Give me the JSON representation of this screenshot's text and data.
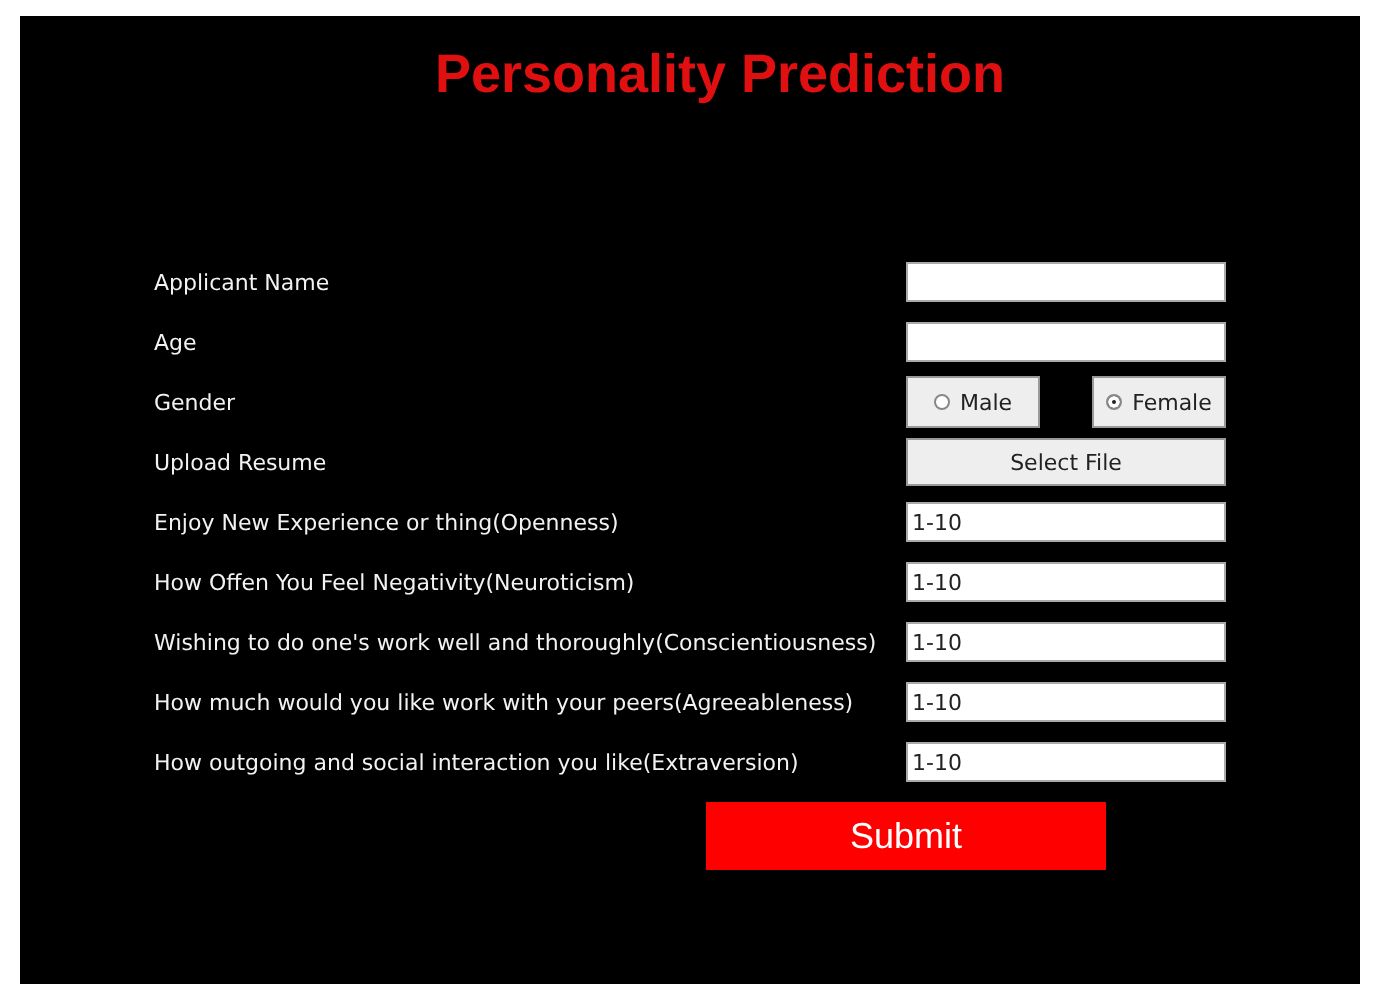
{
  "title": "Personality Prediction",
  "rows": [
    {
      "kind": "text",
      "label": "Applicant Name",
      "value": ""
    },
    {
      "kind": "text",
      "label": "Age",
      "value": ""
    },
    {
      "kind": "radio",
      "label": "Gender",
      "options": [
        {
          "label": "Male",
          "selected": false
        },
        {
          "label": "Female",
          "selected": true
        }
      ]
    },
    {
      "kind": "file",
      "label": "Upload Resume",
      "button": "Select File"
    },
    {
      "kind": "text",
      "label": "Enjoy New Experience or thing(Openness)",
      "value": "1-10"
    },
    {
      "kind": "text",
      "label": "How Offen You Feel Negativity(Neuroticism)",
      "value": "1-10"
    },
    {
      "kind": "text",
      "label": "Wishing to do one's work well and thoroughly(Conscientiousness)",
      "value": "1-10"
    },
    {
      "kind": "text",
      "label": "How much would you like work with your peers(Agreeableness)",
      "value": "1-10"
    },
    {
      "kind": "text",
      "label": "How outgoing and social interaction you like(Extraversion)",
      "value": "1-10"
    }
  ],
  "submit": "Submit"
}
